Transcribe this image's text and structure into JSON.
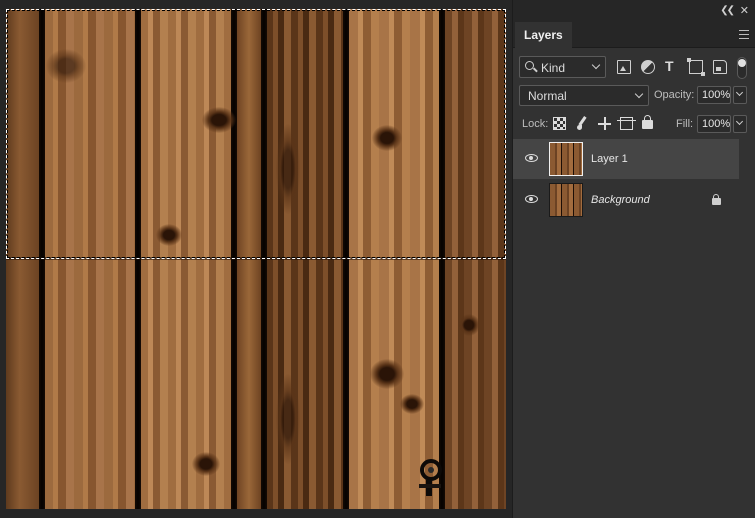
{
  "panel": {
    "tab_label": "Layers",
    "filter": {
      "kind_value": "Kind",
      "icons": [
        "image-filter-icon",
        "adjustment-filter-icon",
        "type-filter-icon",
        "shape-filter-icon",
        "smart-object-filter-icon"
      ]
    },
    "blend_mode": "Normal",
    "opacity_label": "Opacity:",
    "opacity_value": "100%",
    "lock_label": "Lock:",
    "fill_label": "Fill:",
    "fill_value": "100%"
  },
  "layers": [
    {
      "name": "Layer 1",
      "visible": true,
      "selected": true,
      "locked": false
    },
    {
      "name": "Background",
      "visible": true,
      "selected": false,
      "locked": true
    }
  ],
  "colors": {
    "panel_bg": "#323232",
    "selected_row": "#454545",
    "app_bg": "#262626"
  }
}
